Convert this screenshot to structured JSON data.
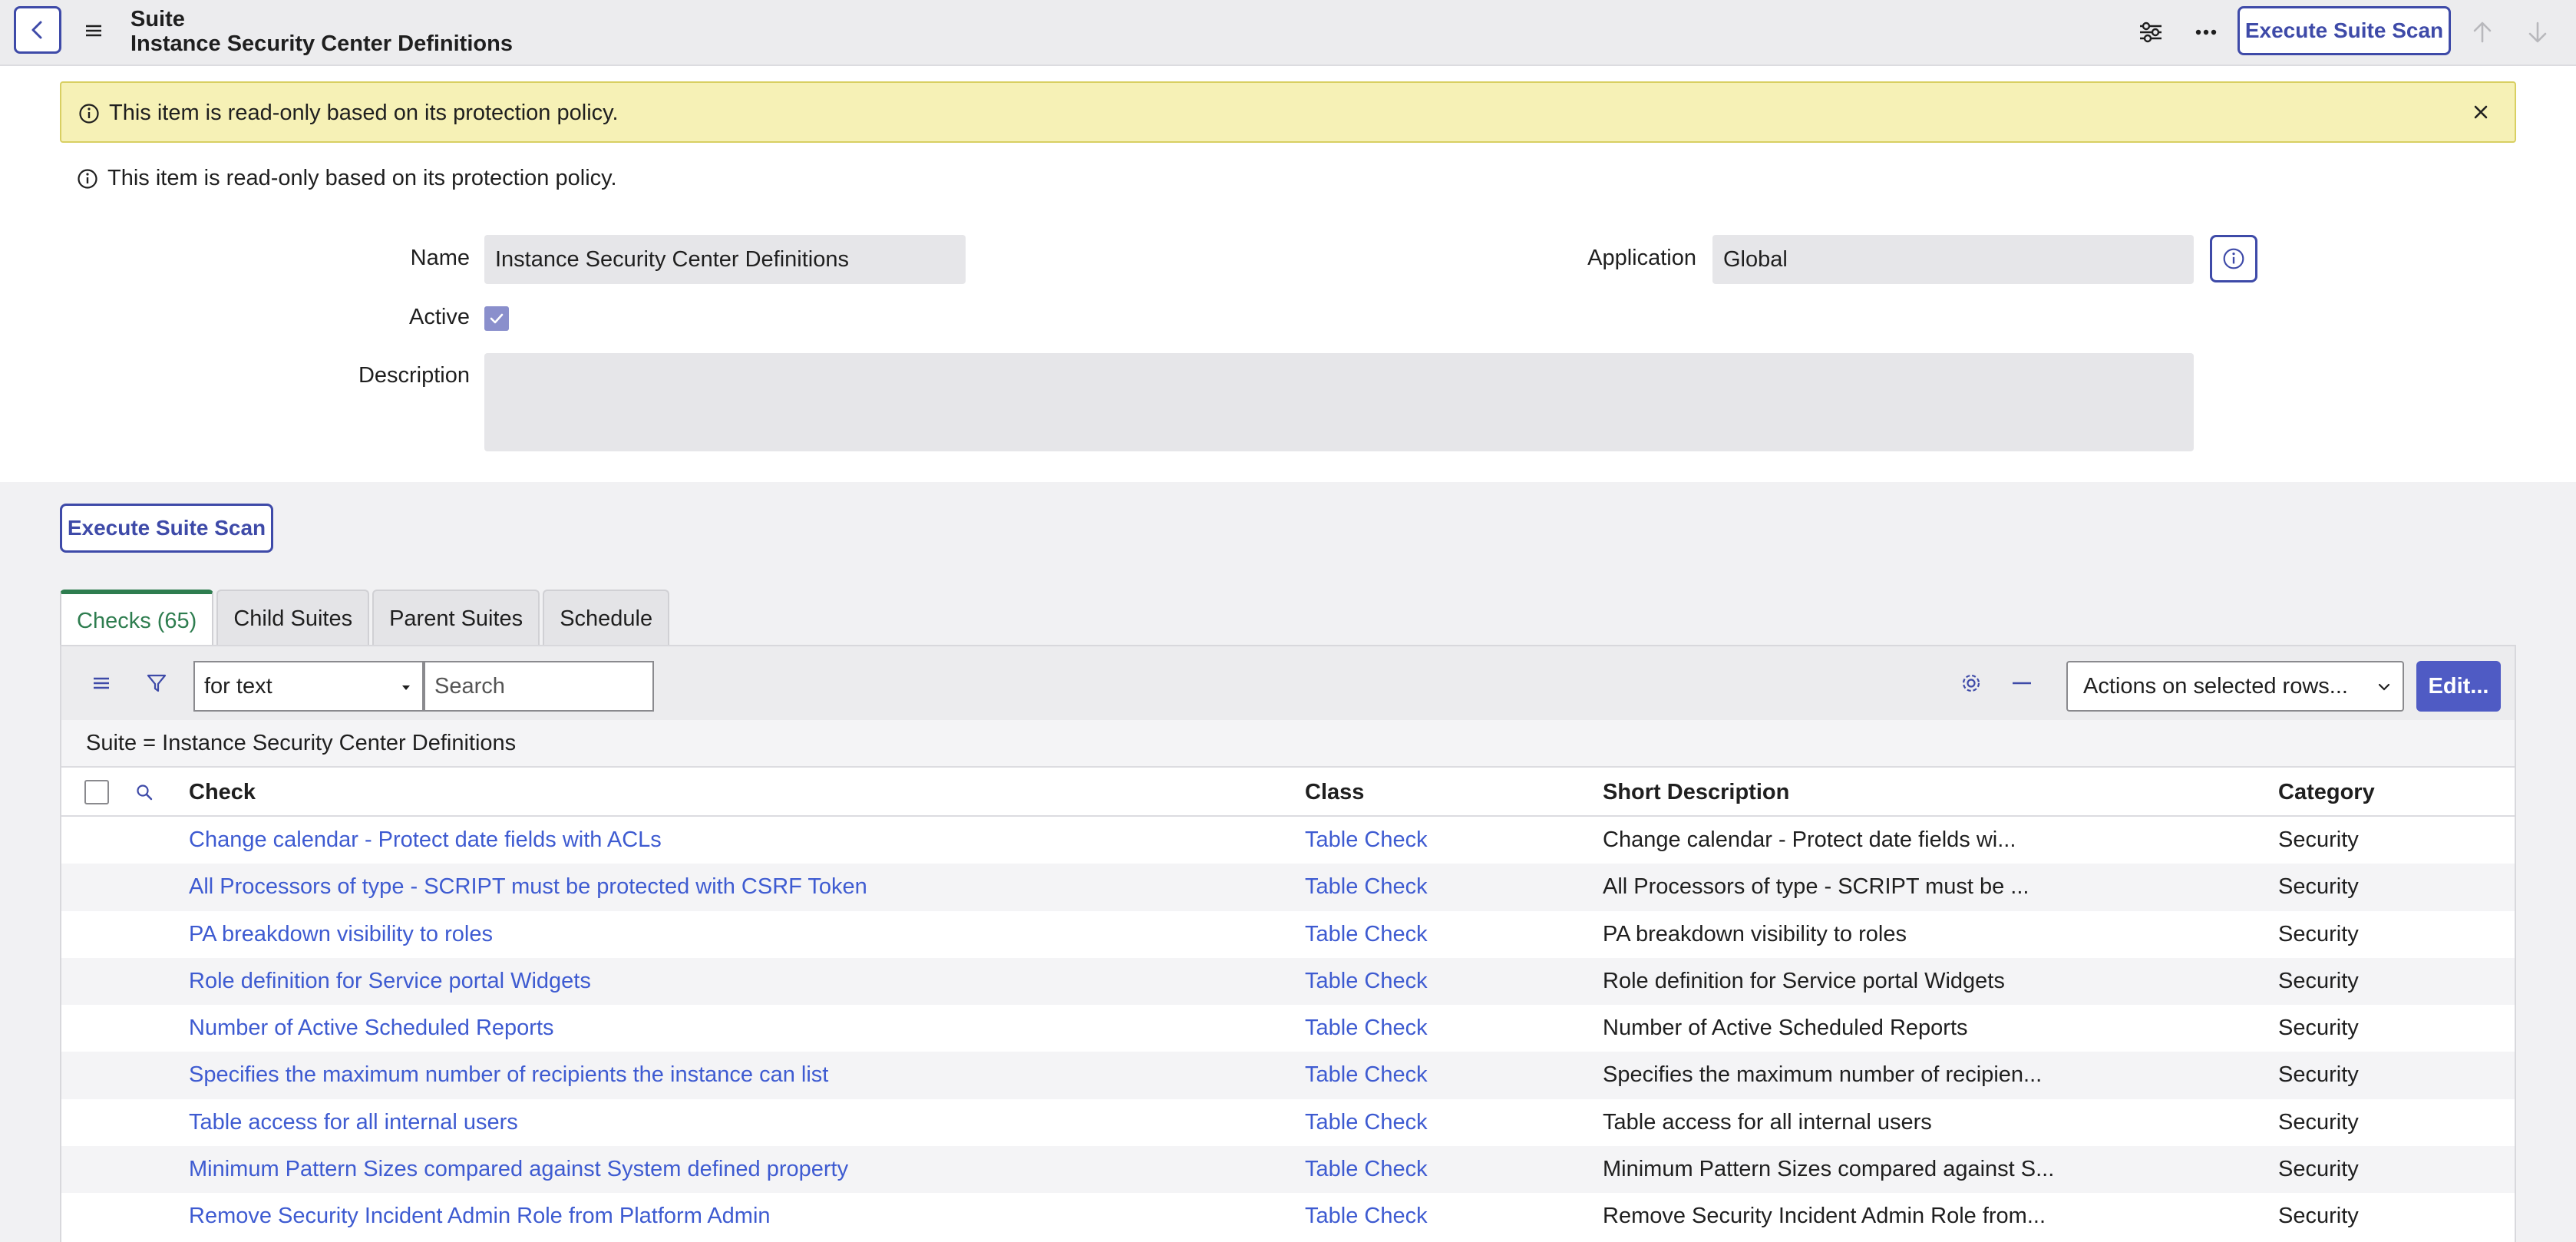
{
  "header": {
    "record_type": "Suite",
    "record_name": "Instance Security Center Definitions",
    "execute_label": "Execute Suite Scan"
  },
  "alert": {
    "message": "This item is read-only based on its protection policy."
  },
  "notice": {
    "message": "This item is read-only based on its protection policy."
  },
  "form": {
    "name_label": "Name",
    "name_value": "Instance Security Center Definitions",
    "application_label": "Application",
    "application_value": "Global",
    "active_label": "Active",
    "active_checked": true,
    "description_label": "Description",
    "description_value": ""
  },
  "main": {
    "execute_label": "Execute Suite Scan"
  },
  "tabs": [
    {
      "label": "Checks (65)",
      "active": true
    },
    {
      "label": "Child Suites",
      "active": false
    },
    {
      "label": "Parent Suites",
      "active": false
    },
    {
      "label": "Schedule",
      "active": false
    }
  ],
  "list": {
    "search_field_value": "for text",
    "search_placeholder": "Search",
    "actions_value": "Actions on selected rows...",
    "edit_label": "Edit...",
    "breadcrumb": "Suite = Instance Security Center Definitions",
    "columns": {
      "check": "Check",
      "class": "Class",
      "short_description": "Short Description",
      "category": "Category"
    },
    "rows": [
      {
        "check": "Change calendar - Protect date fields with ACLs",
        "class": "Table Check",
        "short_description": "Change calendar - Protect date fields wi...",
        "category": "Security"
      },
      {
        "check": "All Processors of type - SCRIPT must be protected with CSRF Token",
        "class": "Table Check",
        "short_description": "All Processors of type - SCRIPT must be ...",
        "category": "Security"
      },
      {
        "check": "PA breakdown visibility to roles",
        "class": "Table Check",
        "short_description": "PA breakdown visibility to roles",
        "category": "Security"
      },
      {
        "check": "Role definition for Service portal Widgets",
        "class": "Table Check",
        "short_description": "Role definition for Service portal Widgets",
        "category": "Security"
      },
      {
        "check": "Number of Active Scheduled Reports",
        "class": "Table Check",
        "short_description": "Number of Active Scheduled Reports",
        "category": "Security"
      },
      {
        "check": "Specifies the maximum number of recipients the instance can list",
        "class": "Table Check",
        "short_description": "Specifies the maximum number of recipien...",
        "category": "Security"
      },
      {
        "check": "Table access for all internal users",
        "class": "Table Check",
        "short_description": "Table access for all internal users",
        "category": "Security"
      },
      {
        "check": "Minimum Pattern Sizes compared against System defined property",
        "class": "Table Check",
        "short_description": "Minimum Pattern Sizes compared against S...",
        "category": "Security"
      },
      {
        "check": "Remove Security Incident Admin Role from Platform Admin",
        "class": "Table Check",
        "short_description": "Remove Security Incident Admin Role from...",
        "category": "Security"
      }
    ]
  },
  "colors": {
    "accent": "#3e4aa8",
    "link": "#3e5bd1",
    "active_tab": "#2e7d4f",
    "alert_bg": "#f6f1b6",
    "edit_button": "#4f5bc4"
  }
}
